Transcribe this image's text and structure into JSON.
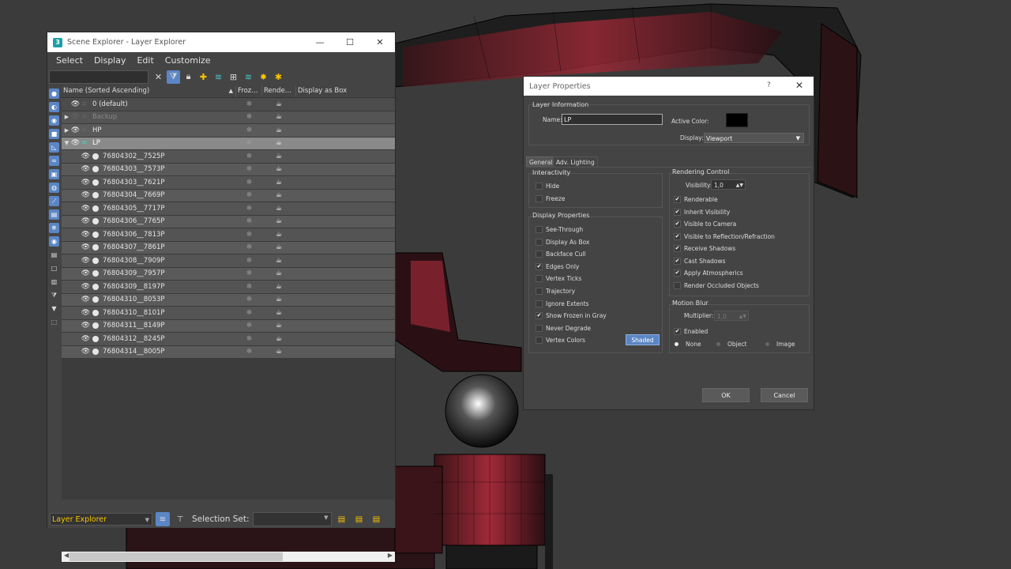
{
  "scene_explorer": {
    "title": "Scene Explorer - Layer Explorer",
    "window_controls": {
      "minimize": "—",
      "maximize": "☐",
      "close": "✕"
    },
    "menu": [
      "Select",
      "Display",
      "Edit",
      "Customize"
    ],
    "columns": {
      "name": "Name (Sorted Ascending)",
      "sort_arrow": "▲",
      "frozen": "Froz...",
      "renderable": "Rende...",
      "display_as_box": "Display as Box"
    },
    "layers": [
      {
        "name": "0 (default)",
        "kind": "layer",
        "expand": ""
      },
      {
        "name": "Backup",
        "kind": "layer-dim",
        "expand": "▶"
      },
      {
        "name": "HP",
        "kind": "layer",
        "expand": "▶"
      },
      {
        "name": "LP",
        "kind": "layer-selected",
        "expand": "▼"
      }
    ],
    "objects": [
      "76804302__7525P",
      "76804303__7573P",
      "76804303__7621P",
      "76804304__7669P",
      "76804305__7717P",
      "76804306__7765P",
      "76804306__7813P",
      "76804307__7861P",
      "76804308__7909P",
      "76804309__7957P",
      "76804309__8197P",
      "76804310__8053P",
      "76804310__8101P",
      "76804311__8149P",
      "76804312__8245P",
      "76804314__8005P"
    ],
    "bottom": {
      "explorer_select": "Layer Explorer",
      "selection_set_label": "Selection Set:"
    }
  },
  "layer_properties": {
    "title": "Layer Properties",
    "help": "?",
    "close": "✕",
    "layer_information": {
      "group_label": "Layer Information",
      "name_label": "Name:",
      "name_value": "LP",
      "active_color_label": "Active Color:",
      "active_color": "#000000",
      "display_label": "Display:",
      "display_value": "Viewport"
    },
    "tabs": {
      "general": "General",
      "adv_lighting": "Adv. Lighting"
    },
    "interactivity": {
      "label": "Interactivity",
      "hide": "Hide",
      "freeze": "Freeze"
    },
    "display_properties": {
      "label": "Display Properties",
      "items": [
        {
          "label": "See-Through",
          "checked": false
        },
        {
          "label": "Display As Box",
          "checked": false
        },
        {
          "label": "Backface Cull",
          "checked": false
        },
        {
          "label": "Edges Only",
          "checked": true
        },
        {
          "label": "Vertex Ticks",
          "checked": false
        },
        {
          "label": "Trajectory",
          "checked": false
        },
        {
          "label": "Ignore Extents",
          "checked": false
        },
        {
          "label": "Show Frozen in Gray",
          "checked": true
        },
        {
          "label": "Never Degrade",
          "checked": false
        },
        {
          "label": "Vertex Colors",
          "checked": false
        }
      ],
      "shaded_button": "Shaded"
    },
    "rendering_control": {
      "label": "Rendering Control",
      "visibility_label": "Visibility:",
      "visibility_value": "1,0",
      "items": [
        {
          "label": "Renderable",
          "checked": true
        },
        {
          "label": "Inherit Visibility",
          "checked": true
        },
        {
          "label": "Visible to Camera",
          "checked": true
        },
        {
          "label": "Visible to Reflection/Refraction",
          "checked": true
        },
        {
          "label": "Receive Shadows",
          "checked": true
        },
        {
          "label": "Cast Shadows",
          "checked": true
        },
        {
          "label": "Apply Atmospherics",
          "checked": true
        },
        {
          "label": "Render Occluded Objects",
          "checked": false
        }
      ]
    },
    "motion_blur": {
      "label": "Motion Blur",
      "multiplier_label": "Multiplier:",
      "multiplier_value": "1,0",
      "enabled_label": "Enabled",
      "enabled": true,
      "radios": [
        {
          "label": "None",
          "selected": true
        },
        {
          "label": "Object",
          "selected": false
        },
        {
          "label": "Image",
          "selected": false
        }
      ]
    },
    "ok": "OK",
    "cancel": "Cancel"
  },
  "colors": {
    "accent": "#5b86c5",
    "selection_yellow": "#f5c400",
    "model_red": "#8a2430"
  }
}
